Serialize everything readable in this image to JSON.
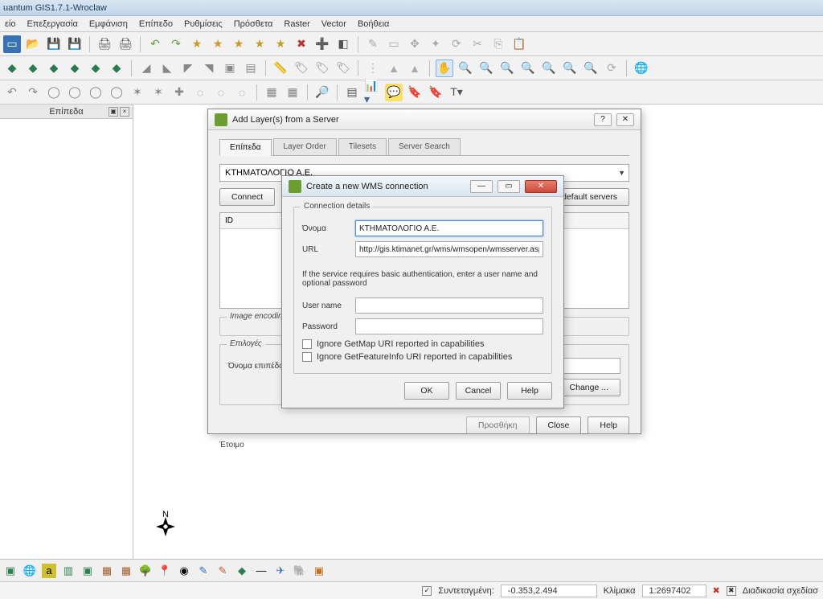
{
  "title": "uantum GIS1.7.1-Wroclaw",
  "menu": [
    "είο",
    "Επεξεργασία",
    "Εμφάνιση",
    "Επίπεδο",
    "Ρυθμίσεις",
    "Πρόσθετα",
    "Raster",
    "Vector",
    "Βοήθεια"
  ],
  "sidebar_tab": "Επίπεδα",
  "addlayer": {
    "title": "Add Layer(s) from a Server",
    "tabs": [
      "Επίπεδα",
      "Layer Order",
      "Tilesets",
      "Server Search"
    ],
    "server_selected": "ΚΤΗΜΑΤΟΛΟΓΙΟ Α.Ε.",
    "btn_connect": "Connect",
    "btn_default": "Add default servers",
    "col_id": "ID",
    "grp_encoding": "Image encoding",
    "grp_options": "Επιλογές",
    "lbl_layername": "Όνομα επιπέδου",
    "btn_change": "Change ...",
    "btn_add": "Προσθήκη",
    "btn_close": "Close",
    "btn_help": "Help",
    "ready": "Έτοιμο"
  },
  "wms": {
    "title": "Create a new WMS connection",
    "grp_details": "Connection details",
    "lbl_name": "Όνομα",
    "val_name": "ΚΤΗΜΑΤΟΛΟΓΙΟ Α.Ε.",
    "lbl_url": "URL",
    "val_url": "http://gis.ktimanet.gr/wms/wmsopen/wmsserver.aspx",
    "auth_hint": "If the service requires basic authentication, enter a user name and optional password",
    "lbl_user": "User name",
    "lbl_pass": "Password",
    "chk_getmap": "Ignore GetMap URI reported in capabilities",
    "chk_getfeature": "Ignore GetFeatureInfo URI reported in capabilities",
    "btn_ok": "OK",
    "btn_cancel": "Cancel",
    "btn_help": "Help"
  },
  "status": {
    "lbl_coord": "Συντεταγμένη:",
    "coord": "-0.353,2.494",
    "lbl_scale": "Κλίμακα",
    "scale": "1:2697402",
    "render": "Διαδικασία σχεδίασ"
  },
  "compass_n": "N"
}
